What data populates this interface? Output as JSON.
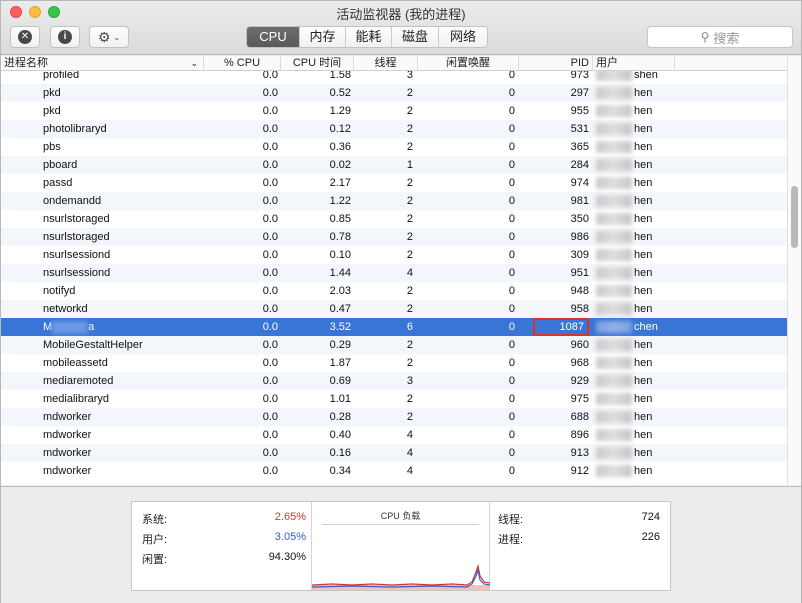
{
  "window": {
    "title": "活动监视器 (我的进程)"
  },
  "toolbar": {
    "close_glyph": "✕",
    "info_glyph": "i",
    "gear_glyph": "⚙",
    "chevron_glyph": "⌄",
    "tabs": [
      "CPU",
      "内存",
      "能耗",
      "磁盘",
      "网络"
    ],
    "active_tab": "CPU",
    "search_placeholder": "搜索"
  },
  "columns": {
    "name": "进程名称",
    "cpu_pct": "% CPU",
    "cpu_time": "CPU 时间",
    "threads": "线程",
    "idle_wakeups": "闲置唤醒",
    "pid": "PID",
    "user": "用户"
  },
  "rows": [
    {
      "name": "profiled",
      "cpu": "0.0",
      "time": "1.58",
      "threads": "3",
      "idle": "0",
      "pid": "973",
      "user_suffix": "shen"
    },
    {
      "name": "pkd",
      "cpu": "0.0",
      "time": "0.52",
      "threads": "2",
      "idle": "0",
      "pid": "297",
      "user_suffix": "hen"
    },
    {
      "name": "pkd",
      "cpu": "0.0",
      "time": "1.29",
      "threads": "2",
      "idle": "0",
      "pid": "955",
      "user_suffix": "hen"
    },
    {
      "name": "photolibraryd",
      "cpu": "0.0",
      "time": "0.12",
      "threads": "2",
      "idle": "0",
      "pid": "531",
      "user_suffix": "hen"
    },
    {
      "name": "pbs",
      "cpu": "0.0",
      "time": "0.36",
      "threads": "2",
      "idle": "0",
      "pid": "365",
      "user_suffix": "hen"
    },
    {
      "name": "pboard",
      "cpu": "0.0",
      "time": "0.02",
      "threads": "1",
      "idle": "0",
      "pid": "284",
      "user_suffix": "hen"
    },
    {
      "name": "passd",
      "cpu": "0.0",
      "time": "2.17",
      "threads": "2",
      "idle": "0",
      "pid": "974",
      "user_suffix": "hen"
    },
    {
      "name": "ondemandd",
      "cpu": "0.0",
      "time": "1.22",
      "threads": "2",
      "idle": "0",
      "pid": "981",
      "user_suffix": "hen"
    },
    {
      "name": "nsurlstoraged",
      "cpu": "0.0",
      "time": "0.85",
      "threads": "2",
      "idle": "0",
      "pid": "350",
      "user_suffix": "hen"
    },
    {
      "name": "nsurlstoraged",
      "cpu": "0.0",
      "time": "0.78",
      "threads": "2",
      "idle": "0",
      "pid": "986",
      "user_suffix": "hen"
    },
    {
      "name": "nsurlsessiond",
      "cpu": "0.0",
      "time": "0.10",
      "threads": "2",
      "idle": "0",
      "pid": "309",
      "user_suffix": "hen"
    },
    {
      "name": "nsurlsessiond",
      "cpu": "0.0",
      "time": "1.44",
      "threads": "4",
      "idle": "0",
      "pid": "951",
      "user_suffix": "hen"
    },
    {
      "name": "notifyd",
      "cpu": "0.0",
      "time": "2.03",
      "threads": "2",
      "idle": "0",
      "pid": "948",
      "user_suffix": "hen"
    },
    {
      "name": "networkd",
      "cpu": "0.0",
      "time": "0.47",
      "threads": "2",
      "idle": "0",
      "pid": "958",
      "user_suffix": "hen"
    },
    {
      "name": "M",
      "name_tail": "a",
      "cpu": "0.0",
      "time": "3.52",
      "threads": "6",
      "idle": "0",
      "pid": "1087",
      "user_suffix": "chen",
      "selected": true
    },
    {
      "name": "MobileGestaltHelper",
      "cpu": "0.0",
      "time": "0.29",
      "threads": "2",
      "idle": "0",
      "pid": "960",
      "user_suffix": "hen"
    },
    {
      "name": "mobileassetd",
      "cpu": "0.0",
      "time": "1.87",
      "threads": "2",
      "idle": "0",
      "pid": "968",
      "user_suffix": "hen"
    },
    {
      "name": "mediaremoted",
      "cpu": "0.0",
      "time": "0.69",
      "threads": "3",
      "idle": "0",
      "pid": "929",
      "user_suffix": "hen"
    },
    {
      "name": "medialibraryd",
      "cpu": "0.0",
      "time": "1.01",
      "threads": "2",
      "idle": "0",
      "pid": "975",
      "user_suffix": "hen"
    },
    {
      "name": "mdworker",
      "cpu": "0.0",
      "time": "0.28",
      "threads": "2",
      "idle": "0",
      "pid": "688",
      "user_suffix": "hen"
    },
    {
      "name": "mdworker",
      "cpu": "0.0",
      "time": "0.40",
      "threads": "4",
      "idle": "0",
      "pid": "896",
      "user_suffix": "hen"
    },
    {
      "name": "mdworker",
      "cpu": "0.0",
      "time": "0.16",
      "threads": "4",
      "idle": "0",
      "pid": "913",
      "user_suffix": "hen"
    },
    {
      "name": "mdworker",
      "cpu": "0.0",
      "time": "0.34",
      "threads": "4",
      "idle": "0",
      "pid": "912",
      "user_suffix": "hen"
    }
  ],
  "stats": {
    "system_label": "系统:",
    "system_value": "2.65%",
    "user_label": "用户:",
    "user_value": "3.05%",
    "idle_label": "闲置:",
    "idle_value": "94.30%",
    "chart_title": "CPU 负载",
    "threads_label": "线程:",
    "threads_value": "724",
    "processes_label": "进程:",
    "processes_value": "226"
  },
  "colors": {
    "selection": "#3875d7",
    "system": "#d9342b",
    "user": "#2f5fd0",
    "highlight_box": "#d9342b"
  }
}
